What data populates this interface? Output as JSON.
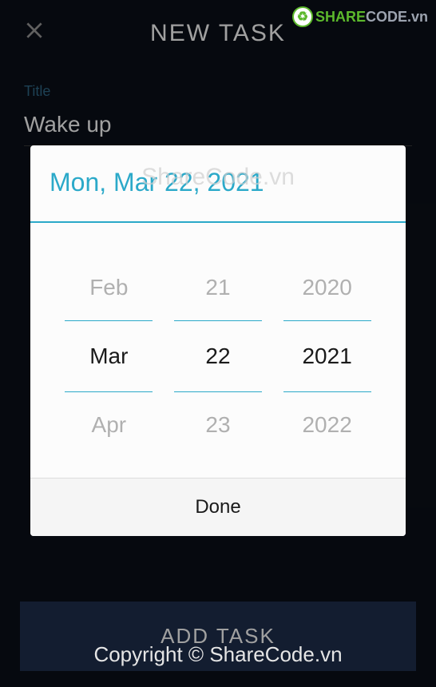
{
  "header": {
    "title": "NEW TASK"
  },
  "form": {
    "title_label": "Title",
    "title_value": "Wake up"
  },
  "dialog": {
    "header": "Mon, Mar 22, 2021",
    "month": {
      "prev": "Feb",
      "current": "Mar",
      "next": "Apr"
    },
    "day": {
      "prev": "21",
      "current": "22",
      "next": "23"
    },
    "year": {
      "prev": "2020",
      "current": "2021",
      "next": "2022"
    },
    "done": "Done"
  },
  "add_button": "ADD TASK",
  "watermark": {
    "logo_share": "SHARE",
    "logo_code": "CODE",
    "logo_suffix": ".vn",
    "center": "ShareCode.vn",
    "footer": "Copyright © ShareCode.vn"
  }
}
